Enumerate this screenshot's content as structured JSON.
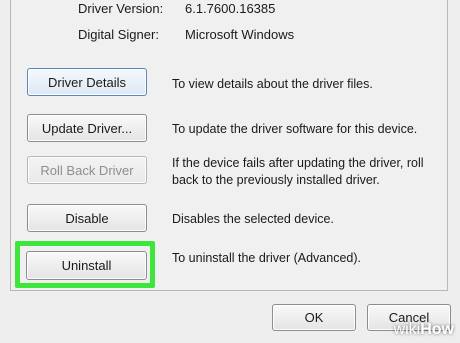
{
  "info": {
    "driver_version_label": "Driver Version:",
    "driver_version_value": "6.1.7600.16385",
    "digital_signer_label": "Digital Signer:",
    "digital_signer_value": "Microsoft Windows"
  },
  "actions": [
    {
      "button": "Driver Details",
      "description": "To view details about the driver files."
    },
    {
      "button": "Update Driver...",
      "description": "To update the driver software for this device."
    },
    {
      "button": "Roll Back Driver",
      "description": "If the device fails after updating the driver, roll back to the previously installed driver."
    },
    {
      "button": "Disable",
      "description": "Disables the selected device."
    },
    {
      "button": "Uninstall",
      "description": "To uninstall the driver (Advanced)."
    }
  ],
  "footer": {
    "ok_label": "OK",
    "cancel_label": "Cancel"
  },
  "watermark": {
    "part1": "wiki",
    "part2": "How"
  },
  "colors": {
    "highlight": "#3ee53b",
    "focus_border": "#5a88b8"
  }
}
